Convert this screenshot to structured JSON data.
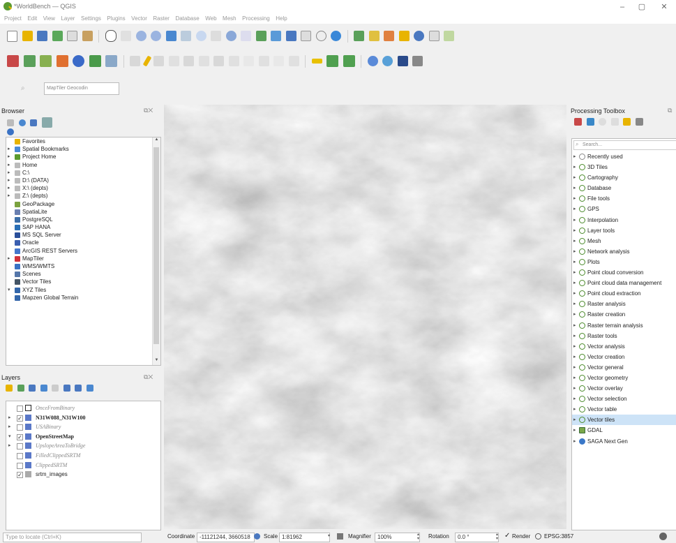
{
  "window": {
    "title": "*WorldBench — QGIS"
  },
  "menu": [
    "Project",
    "Edit",
    "View",
    "Layer",
    "Settings",
    "Plugins",
    "Vector",
    "Raster",
    "Database",
    "Web",
    "Mesh",
    "Processing",
    "Help"
  ],
  "locator": {
    "placeholder": "MapTiler Geocodin"
  },
  "browser": {
    "title": "Browser",
    "items": [
      {
        "label": "Favorites",
        "icon": "star-icon",
        "color": "#e8b400",
        "arrow": ""
      },
      {
        "label": "Spatial Bookmarks",
        "icon": "bookmark-icon",
        "color": "#4b8ad6",
        "arrow": "▸"
      },
      {
        "label": "Project Home",
        "icon": "project-home-icon",
        "color": "#5b9a2f",
        "arrow": "▸"
      },
      {
        "label": "Home",
        "icon": "home-folder-icon",
        "color": "#bbb",
        "arrow": "▸"
      },
      {
        "label": "C:\\",
        "icon": "drive-icon",
        "color": "#bbb",
        "arrow": "▸"
      },
      {
        "label": "D:\\ (DATA)",
        "icon": "drive-icon",
        "color": "#bbb",
        "arrow": "▸"
      },
      {
        "label": "X:\\ (depts)",
        "icon": "drive-icon",
        "color": "#bbb",
        "arrow": "▸"
      },
      {
        "label": "Z:\\ (depts)",
        "icon": "drive-icon",
        "color": "#bbb",
        "arrow": "▸"
      },
      {
        "label": "GeoPackage",
        "icon": "geopackage-icon",
        "color": "#7ba23f",
        "arrow": ""
      },
      {
        "label": "SpatiaLite",
        "icon": "spatialite-icon",
        "color": "#6a7fb0",
        "arrow": ""
      },
      {
        "label": "PostgreSQL",
        "icon": "postgresql-icon",
        "color": "#3c6ea8",
        "arrow": ""
      },
      {
        "label": "SAP HANA",
        "icon": "sap-hana-icon",
        "color": "#2a6fb6",
        "arrow": ""
      },
      {
        "label": "MS SQL Server",
        "icon": "mssql-icon",
        "color": "#2a4f9a",
        "arrow": ""
      },
      {
        "label": "Oracle",
        "icon": "oracle-icon",
        "color": "#3a5fb0",
        "arrow": ""
      },
      {
        "label": "ArcGIS REST Servers",
        "icon": "arcgis-icon",
        "color": "#4477cc",
        "arrow": ""
      },
      {
        "label": "MapTiler",
        "icon": "maptiler-icon",
        "color": "#d0313a",
        "arrow": "▸"
      },
      {
        "label": "WMS/WMTS",
        "icon": "wms-icon",
        "color": "#3a72c4",
        "arrow": ""
      },
      {
        "label": "Scenes",
        "icon": "scenes-icon",
        "color": "#5577aa",
        "arrow": ""
      },
      {
        "label": "Vector Tiles",
        "icon": "vector-tiles-icon",
        "color": "#445566",
        "arrow": ""
      },
      {
        "label": "XYZ Tiles",
        "icon": "xyz-tiles-icon",
        "color": "#3366aa",
        "arrow": "▾"
      },
      {
        "label": "Mapzen Global Terrain",
        "icon": "xyz-tiles-icon",
        "color": "#3366aa",
        "arrow": ""
      }
    ]
  },
  "layers": {
    "title": "Layers",
    "items": [
      {
        "label": "OnceFromBinary",
        "style": "italic",
        "checked": false,
        "arrow": "",
        "icon": "polygon-layer-icon",
        "color": "#fff"
      },
      {
        "label": "N31W088_N31W100",
        "style": "bold",
        "checked": true,
        "arrow": "▸",
        "icon": "raster-layer-icon",
        "color": "#5a78c8"
      },
      {
        "label": "USABinary",
        "style": "italic",
        "checked": false,
        "arrow": "▸",
        "icon": "raster-layer-icon",
        "color": "#5a78c8"
      },
      {
        "label": "OpenStreetMap",
        "style": "bold",
        "checked": true,
        "arrow": "▾",
        "icon": "raster-layer-icon",
        "color": "#5a78c8"
      },
      {
        "label": "UpslopeAreaToBridge",
        "style": "italic",
        "checked": false,
        "arrow": "▸",
        "icon": "raster-layer-icon",
        "color": "#5a78c8"
      },
      {
        "label": "FilledClippedSRTM",
        "style": "italic",
        "checked": false,
        "arrow": "",
        "icon": "raster-layer-icon",
        "color": "#5a78c8"
      },
      {
        "label": "ClippedSRTM",
        "style": "italic",
        "checked": false,
        "arrow": "",
        "icon": "raster-layer-icon",
        "color": "#5a78c8"
      },
      {
        "label": "srtm_images",
        "style": "normal",
        "checked": true,
        "arrow": "",
        "icon": "raster-layer-icon",
        "color": "#aaa"
      }
    ]
  },
  "processing": {
    "title": "Processing Toolbox",
    "search_placeholder": "Search...",
    "items": [
      "Recently used",
      "3D Tiles",
      "Cartography",
      "Database",
      "File tools",
      "GPS",
      "Interpolation",
      "Layer tools",
      "Mesh",
      "Network analysis",
      "Plots",
      "Point cloud conversion",
      "Point cloud data management",
      "Point cloud extraction",
      "Raster analysis",
      "Raster creation",
      "Raster terrain analysis",
      "Raster tools",
      "Vector analysis",
      "Vector creation",
      "Vector general",
      "Vector geometry",
      "Vector overlay",
      "Vector selection",
      "Vector table",
      "Vector tiles",
      "GDAL",
      "SAGA Next Gen"
    ]
  },
  "status": {
    "locator_placeholder": "Type to locate (Ctrl+K)",
    "coordinate_label": "Coordinate",
    "coordinate": "-11121244, 3660518",
    "scale_label": "Scale",
    "scale": "1:81962",
    "magnifier_label": "Magnifier",
    "magnifier": "100%",
    "rotation_label": "Rotation",
    "rotation": "0.0 °",
    "render_label": "Render",
    "crs": "EPSG:3857"
  },
  "colors": {
    "accent": "#5b9a2f",
    "selection": "#cde3f7",
    "canvas": "#c9c9c9"
  }
}
